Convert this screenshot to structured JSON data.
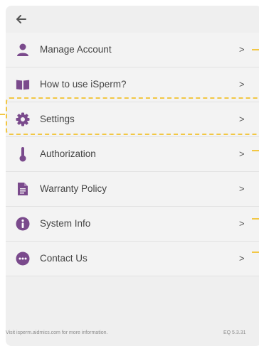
{
  "header": {
    "back_icon": "arrow-left-icon"
  },
  "colors": {
    "accent": "#7a4a8c",
    "annotation": "#f2c744",
    "panel": "#efefef"
  },
  "menu": {
    "items": [
      {
        "label": "Manage Account",
        "icon": "user-icon",
        "chevron": ">"
      },
      {
        "label": "How to use iSperm?",
        "icon": "book-icon",
        "chevron": ">"
      },
      {
        "label": "Settings",
        "icon": "gear-icon",
        "chevron": ">"
      },
      {
        "label": "Authorization",
        "icon": "thermometer-icon",
        "chevron": ">"
      },
      {
        "label": "Warranty Policy",
        "icon": "document-icon",
        "chevron": ">"
      },
      {
        "label": "System Info",
        "icon": "info-icon",
        "chevron": ">"
      },
      {
        "label": "Contact Us",
        "icon": "chat-icon",
        "chevron": ">"
      }
    ]
  },
  "footer": {
    "prefix": "Visit ",
    "link": "isperm.aidmics.com",
    "suffix": " for more information.",
    "version": "EQ 5.3.31"
  }
}
